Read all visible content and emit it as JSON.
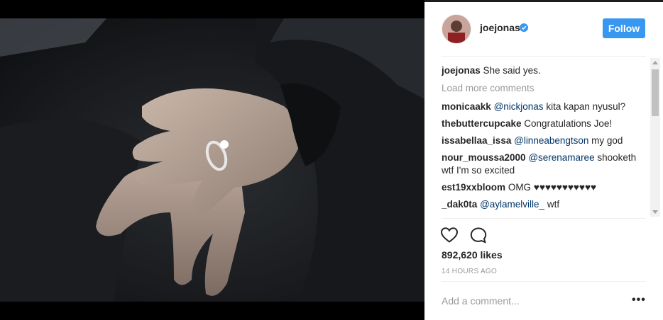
{
  "post": {
    "username": "joejonas",
    "follow_label": "Follow",
    "caption_text": "She said yes.",
    "load_more": "Load more comments",
    "comments": [
      {
        "user": "monicaakk",
        "mention": "@nickjonas",
        "text": " kita kapan nyusul?"
      },
      {
        "user": "thebuttercupcake",
        "mention": "",
        "text": "Congratulations Joe!"
      },
      {
        "user": "issabellaa_issa",
        "mention": "@linneabengtson",
        "text": " my god"
      },
      {
        "user": "nour_moussa2000",
        "mention": "@serenamaree",
        "text": " shooketh wtf I'm so excited"
      },
      {
        "user": "est19xxbloom",
        "mention": "",
        "text": "OMG ♥♥♥♥♥♥♥♥♥♥♥"
      },
      {
        "user": "_dak0ta",
        "mention": "@aylamelville_",
        "text": " wtf"
      }
    ],
    "likes": "892,620 likes",
    "timestamp": "14 HOURS AGO",
    "comment_placeholder": "Add a comment...",
    "more_options": "•••"
  },
  "icons": {
    "like": "heart-icon",
    "comment": "comment-bubble-icon",
    "verified": "verified-badge-icon"
  },
  "colors": {
    "accent": "#3897f0",
    "mention": "#003569",
    "muted": "#999999"
  }
}
